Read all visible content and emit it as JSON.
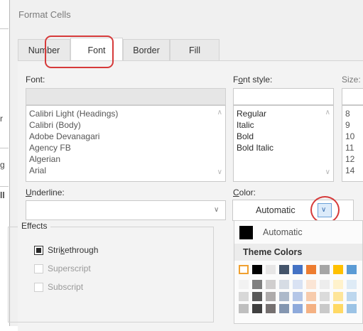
{
  "dialog": {
    "title": "Format Cells"
  },
  "tabs": [
    {
      "label": "Number",
      "active": false
    },
    {
      "label": "Font",
      "active": true
    },
    {
      "label": "Border",
      "active": false
    },
    {
      "label": "Fill",
      "active": false
    }
  ],
  "font": {
    "label": "Font:",
    "value": "",
    "items": [
      "Calibri Light (Headings)",
      "Calibri (Body)",
      "Adobe Devanagari",
      "Agency FB",
      "Algerian",
      "Arial"
    ]
  },
  "font_style": {
    "label_pre": "F",
    "label_u": "o",
    "label_post": "nt style:",
    "value": "",
    "items": [
      "Regular",
      "Italic",
      "Bold",
      "Bold Italic"
    ]
  },
  "size": {
    "label": "Size:",
    "items": [
      "8",
      "9",
      "10",
      "11",
      "12",
      "14"
    ]
  },
  "underline": {
    "label_u": "U",
    "label_post": "nderline:",
    "value": ""
  },
  "color": {
    "label_u": "C",
    "label_post": "olor:",
    "value": "Automatic",
    "popup": {
      "automatic_label": "Automatic",
      "theme_header": "Theme Colors",
      "theme_row": [
        "#ffffff",
        "#000000",
        "#e7e6e6",
        "#44546a",
        "#4472c4",
        "#ed7d31",
        "#a5a5a5",
        "#ffc000",
        "#5b9bd5"
      ],
      "shade_rows": [
        [
          "#f2f2f2",
          "#7f7f7f",
          "#d0cece",
          "#d6dce4",
          "#d9e2f3",
          "#fbe5d5",
          "#ededed",
          "#fff2cc",
          "#deebf6"
        ],
        [
          "#d8d8d8",
          "#595959",
          "#aeabab",
          "#adb9ca",
          "#b4c6e7",
          "#f7cbac",
          "#dbdbdb",
          "#fee599",
          "#bdd7ee"
        ],
        [
          "#bfbfbf",
          "#3f3f3f",
          "#757070",
          "#8496b0",
          "#8eaadb",
          "#f4b183",
          "#c9c9c9",
          "#ffd965",
          "#9cc3e5"
        ]
      ]
    }
  },
  "effects": {
    "legend": "Effects",
    "strikethrough": {
      "pre": "Stri",
      "u": "k",
      "post": "ethrough",
      "checked": true
    },
    "superscript": {
      "label": "Superscript",
      "checked": false
    },
    "subscript": {
      "label": "Subscript",
      "checked": false
    }
  },
  "background_fragments": [
    "r",
    "g",
    "ll"
  ],
  "colors": {
    "highlight": "#d63a3a",
    "dropdown_accent": "#6aa0d8"
  }
}
